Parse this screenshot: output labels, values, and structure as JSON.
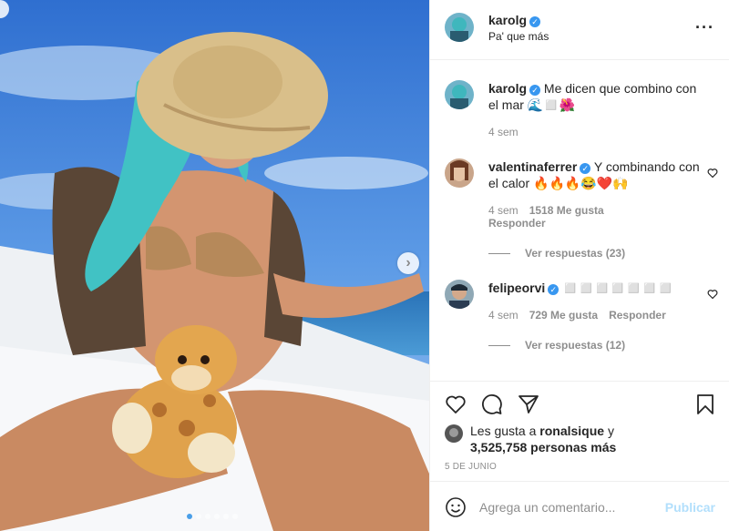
{
  "post": {
    "username": "karolg",
    "location": "Pa' que más"
  },
  "caption": {
    "username": "karolg",
    "text": "Me dicen que combino con el mar 🌊◻️🌺",
    "time": "4 sem"
  },
  "comments": [
    {
      "username": "valentinaferrer",
      "text": "Y combinando con el calor 🔥🔥🔥😂❤️🙌",
      "time": "4 sem",
      "likes": "1518 Me gusta",
      "reply_label": "Responder",
      "view_replies": "Ver respuestas (23)"
    },
    {
      "username": "felipeorvi",
      "text": "◻️◻️◻️◻️◻️◻️◻️",
      "time": "4 sem",
      "likes": "729 Me gusta",
      "reply_label": "Responder",
      "view_replies": "Ver respuestas (12)"
    }
  ],
  "likes": {
    "prefix": "Les gusta a ",
    "first_user": "ronalsique",
    "connector": " y",
    "count_text": "3,525,758 personas más"
  },
  "date": "5 DE JUNIO",
  "add_comment": {
    "placeholder": "Agrega un comentario...",
    "publish_label": "Publicar"
  },
  "icons": {
    "more": "more-dots-icon",
    "heart": "heart-icon",
    "comment": "comment-icon",
    "share": "share-icon",
    "save": "bookmark-icon",
    "emoji": "smile-icon",
    "verified": "verified-icon",
    "next": "chevron-right-icon"
  },
  "colors": {
    "verified": "#3897f0",
    "publish_disabled": "#b2dffc",
    "dot_active": "#4a9fe8"
  },
  "carousel": {
    "count": 6,
    "active_index": 0
  }
}
